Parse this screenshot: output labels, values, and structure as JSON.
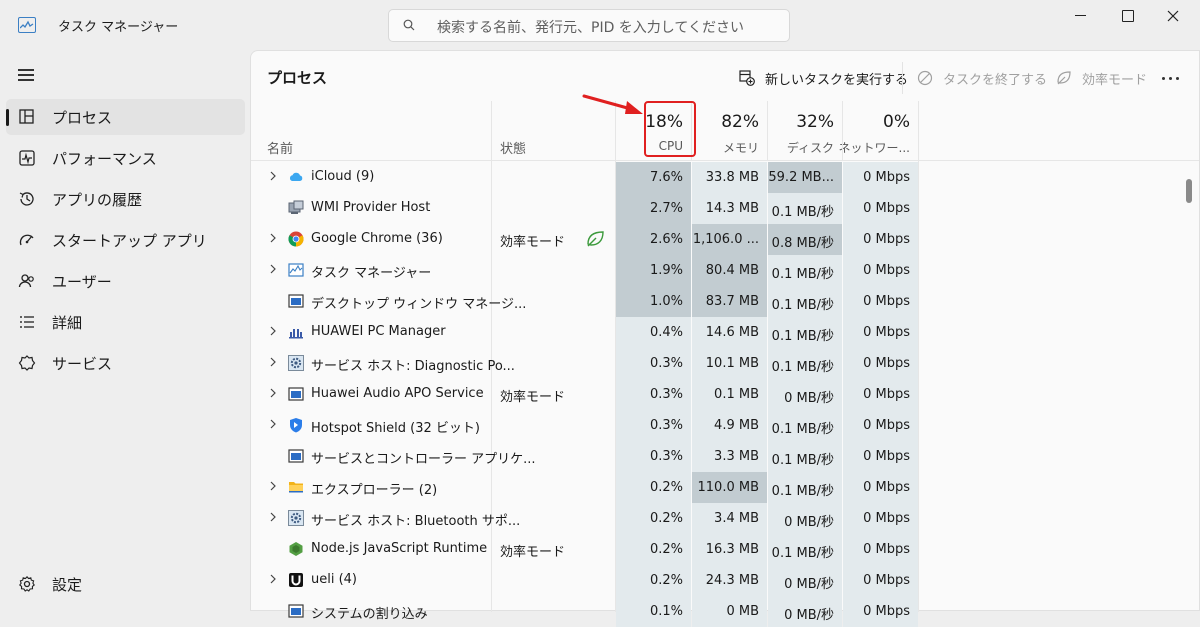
{
  "window": {
    "title": "タスク マネージャー",
    "search_placeholder": "検索する名前、発行元、PID を入力してください"
  },
  "sidebar": {
    "items": [
      {
        "label": "プロセス",
        "icon": "processes-icon",
        "active": true
      },
      {
        "label": "パフォーマンス",
        "icon": "performance-icon"
      },
      {
        "label": "アプリの履歴",
        "icon": "app-history-icon"
      },
      {
        "label": "スタートアップ アプリ",
        "icon": "startup-apps-icon"
      },
      {
        "label": "ユーザー",
        "icon": "users-icon"
      },
      {
        "label": "詳細",
        "icon": "details-icon"
      },
      {
        "label": "サービス",
        "icon": "services-icon"
      }
    ],
    "settings_label": "設定"
  },
  "toolbar": {
    "title": "プロセス",
    "new_task_label": "新しいタスクを実行する",
    "end_task_label": "タスクを終了する",
    "efficiency_label": "効率モード"
  },
  "columns": {
    "name": "名前",
    "status": "状態",
    "cpu": {
      "pct": "18%",
      "label": "CPU"
    },
    "memory": {
      "pct": "82%",
      "label": "メモリ"
    },
    "disk": {
      "pct": "32%",
      "label": "ディスク"
    },
    "network": {
      "pct": "0%",
      "label": "ネットワー..."
    }
  },
  "colors": {
    "heat_strong": "#c2ccd1",
    "heat_light": "#e3eaed",
    "highlight_box": "#e02020"
  },
  "rows": [
    {
      "name": "iCloud (9)",
      "expandable": true,
      "icon": "icloud-icon",
      "status": "",
      "efficiency": false,
      "cpu": "7.6%",
      "memory": "33.8 MB",
      "disk": "59.2 MB...",
      "network": "0 Mbps"
    },
    {
      "name": "WMI Provider Host",
      "expandable": false,
      "icon": "wmi-icon",
      "status": "",
      "efficiency": false,
      "cpu": "2.7%",
      "memory": "14.3 MB",
      "disk": "0.1 MB/秒",
      "network": "0 Mbps"
    },
    {
      "name": "Google Chrome (36)",
      "expandable": true,
      "icon": "chrome-icon",
      "status": "効率モード",
      "efficiency": true,
      "cpu": "2.6%",
      "memory": "1,106.0 ...",
      "disk": "0.8 MB/秒",
      "network": "0 Mbps"
    },
    {
      "name": "タスク マネージャー",
      "expandable": true,
      "icon": "task-manager-icon",
      "status": "",
      "efficiency": false,
      "cpu": "1.9%",
      "memory": "80.4 MB",
      "disk": "0.1 MB/秒",
      "network": "0 Mbps"
    },
    {
      "name": "デスクトップ ウィンドウ マネージ...",
      "expandable": false,
      "icon": "window-icon",
      "status": "",
      "efficiency": false,
      "cpu": "1.0%",
      "memory": "83.7 MB",
      "disk": "0.1 MB/秒",
      "network": "0 Mbps"
    },
    {
      "name": "HUAWEI PC Manager",
      "expandable": true,
      "icon": "huawei-icon",
      "status": "",
      "efficiency": false,
      "cpu": "0.4%",
      "memory": "14.6 MB",
      "disk": "0.1 MB/秒",
      "network": "0 Mbps"
    },
    {
      "name": "サービス ホスト: Diagnostic Po...",
      "expandable": true,
      "icon": "gear-service-icon",
      "status": "",
      "efficiency": false,
      "cpu": "0.3%",
      "memory": "10.1 MB",
      "disk": "0.1 MB/秒",
      "network": "0 Mbps"
    },
    {
      "name": "Huawei Audio APO Service",
      "expandable": true,
      "icon": "window-icon",
      "status": "効率モード",
      "efficiency": false,
      "cpu": "0.3%",
      "memory": "0.1 MB",
      "disk": "0 MB/秒",
      "network": "0 Mbps"
    },
    {
      "name": "Hotspot Shield (32 ビット)",
      "expandable": true,
      "icon": "shield-icon",
      "status": "",
      "efficiency": false,
      "cpu": "0.3%",
      "memory": "4.9 MB",
      "disk": "0.1 MB/秒",
      "network": "0 Mbps"
    },
    {
      "name": "サービスとコントローラー アプリケ...",
      "expandable": false,
      "icon": "window-icon",
      "status": "",
      "efficiency": false,
      "cpu": "0.3%",
      "memory": "3.3 MB",
      "disk": "0.1 MB/秒",
      "network": "0 Mbps"
    },
    {
      "name": "エクスプローラー (2)",
      "expandable": true,
      "icon": "folder-icon",
      "status": "",
      "efficiency": false,
      "cpu": "0.2%",
      "memory": "110.0 MB",
      "disk": "0.1 MB/秒",
      "network": "0 Mbps"
    },
    {
      "name": "サービス ホスト: Bluetooth サポ...",
      "expandable": true,
      "icon": "gear-service-icon",
      "status": "",
      "efficiency": false,
      "cpu": "0.2%",
      "memory": "3.4 MB",
      "disk": "0 MB/秒",
      "network": "0 Mbps"
    },
    {
      "name": "Node.js JavaScript Runtime",
      "expandable": false,
      "icon": "nodejs-icon",
      "status": "効率モード",
      "efficiency": false,
      "cpu": "0.2%",
      "memory": "16.3 MB",
      "disk": "0.1 MB/秒",
      "network": "0 Mbps"
    },
    {
      "name": "ueli (4)",
      "expandable": true,
      "icon": "ueli-icon",
      "status": "",
      "efficiency": false,
      "cpu": "0.2%",
      "memory": "24.3 MB",
      "disk": "0 MB/秒",
      "network": "0 Mbps"
    },
    {
      "name": "システムの割り込み",
      "expandable": false,
      "icon": "window-icon",
      "status": "",
      "efficiency": false,
      "cpu": "0.1%",
      "memory": "0 MB",
      "disk": "0 MB/秒",
      "network": "0 Mbps"
    }
  ],
  "heat": {
    "cpu": [
      "strong",
      "strong",
      "strong",
      "strong",
      "strong",
      "light",
      "light",
      "light",
      "light",
      "light",
      "light",
      "light",
      "light",
      "light",
      "light"
    ],
    "memory": [
      "light",
      "light",
      "strong",
      "strong",
      "strong",
      "light",
      "light",
      "light",
      "light",
      "light",
      "strong",
      "light",
      "light",
      "light",
      "light"
    ],
    "disk": [
      "strong",
      "light",
      "strong",
      "light",
      "light",
      "light",
      "light",
      "light",
      "light",
      "light",
      "light",
      "light",
      "light",
      "light",
      "light"
    ],
    "network": [
      "light",
      "light",
      "light",
      "light",
      "light",
      "light",
      "light",
      "light",
      "light",
      "light",
      "light",
      "light",
      "light",
      "light",
      "light"
    ]
  }
}
